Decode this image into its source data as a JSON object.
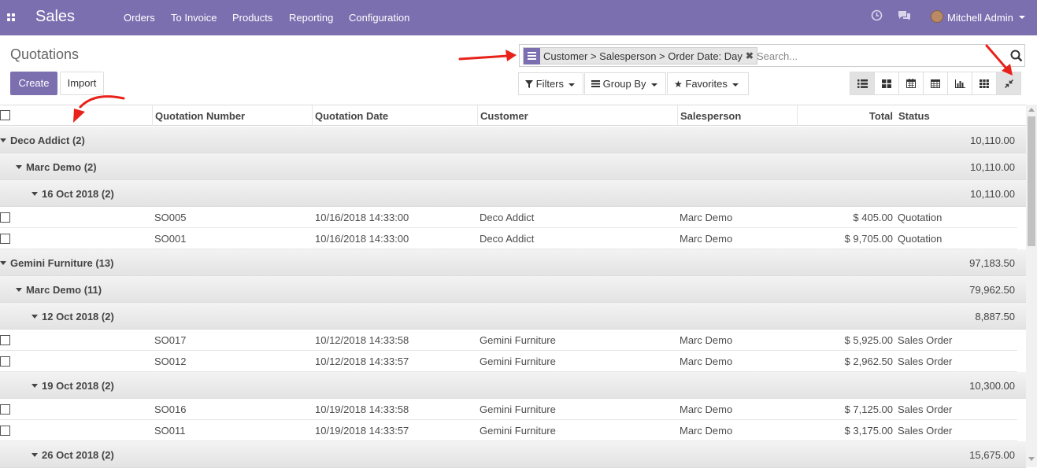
{
  "navbar": {
    "app_name": "Sales",
    "menu": [
      "Orders",
      "To Invoice",
      "Products",
      "Reporting",
      "Configuration"
    ],
    "user_name": "Mitchell Admin",
    "bg_color": "#7c6fb0"
  },
  "page": {
    "title": "Quotations",
    "create_label": "Create",
    "import_label": "Import"
  },
  "search": {
    "facet_text": "Customer > Salesperson > Order Date: Day",
    "placeholder": "Search...",
    "filters_label": "Filters",
    "groupby_label": "Group By",
    "favorites_label": "Favorites"
  },
  "views": [
    "list-view-icon",
    "kanban-view-icon",
    "calendar-view-icon",
    "pivot-view-icon",
    "graph-view-icon",
    "grid-view-icon",
    "collapse-groups-icon"
  ],
  "table": {
    "columns": [
      "Quotation Number",
      "Quotation Date",
      "Customer",
      "Salesperson",
      "Total",
      "Status"
    ],
    "groups": [
      {
        "label": "Deco Addict (2)",
        "total": "10,110.00"
      },
      {
        "label": "Marc Demo (2)",
        "total": "10,110.00"
      },
      {
        "label": "16 Oct 2018 (2)",
        "total": "10,110.00"
      },
      {
        "label": "Gemini Furniture (13)",
        "total": "97,183.50"
      },
      {
        "label": "Marc Demo (11)",
        "total": "79,962.50"
      },
      {
        "label": "12 Oct 2018 (2)",
        "total": "8,887.50"
      },
      {
        "label": "19 Oct 2018 (2)",
        "total": "10,300.00"
      },
      {
        "label": "26 Oct 2018 (2)",
        "total": "15,675.00"
      }
    ],
    "rows": [
      {
        "number": "SO005",
        "date": "10/16/2018 14:33:00",
        "customer": "Deco Addict",
        "salesperson": "Marc Demo",
        "total": "$ 405.00",
        "status": "Quotation"
      },
      {
        "number": "SO001",
        "date": "10/16/2018 14:33:00",
        "customer": "Deco Addict",
        "salesperson": "Marc Demo",
        "total": "$ 9,705.00",
        "status": "Quotation"
      },
      {
        "number": "SO017",
        "date": "10/12/2018 14:33:58",
        "customer": "Gemini Furniture",
        "salesperson": "Marc Demo",
        "total": "$ 5,925.00",
        "status": "Sales Order"
      },
      {
        "number": "SO012",
        "date": "10/12/2018 14:33:57",
        "customer": "Gemini Furniture",
        "salesperson": "Marc Demo",
        "total": "$ 2,962.50",
        "status": "Sales Order"
      },
      {
        "number": "SO016",
        "date": "10/19/2018 14:33:58",
        "customer": "Gemini Furniture",
        "salesperson": "Marc Demo",
        "total": "$ 7,125.00",
        "status": "Sales Order"
      },
      {
        "number": "SO011",
        "date": "10/19/2018 14:33:57",
        "customer": "Gemini Furniture",
        "salesperson": "Marc Demo",
        "total": "$ 3,175.00",
        "status": "Sales Order"
      }
    ]
  },
  "annotation_color": "#e8221b"
}
